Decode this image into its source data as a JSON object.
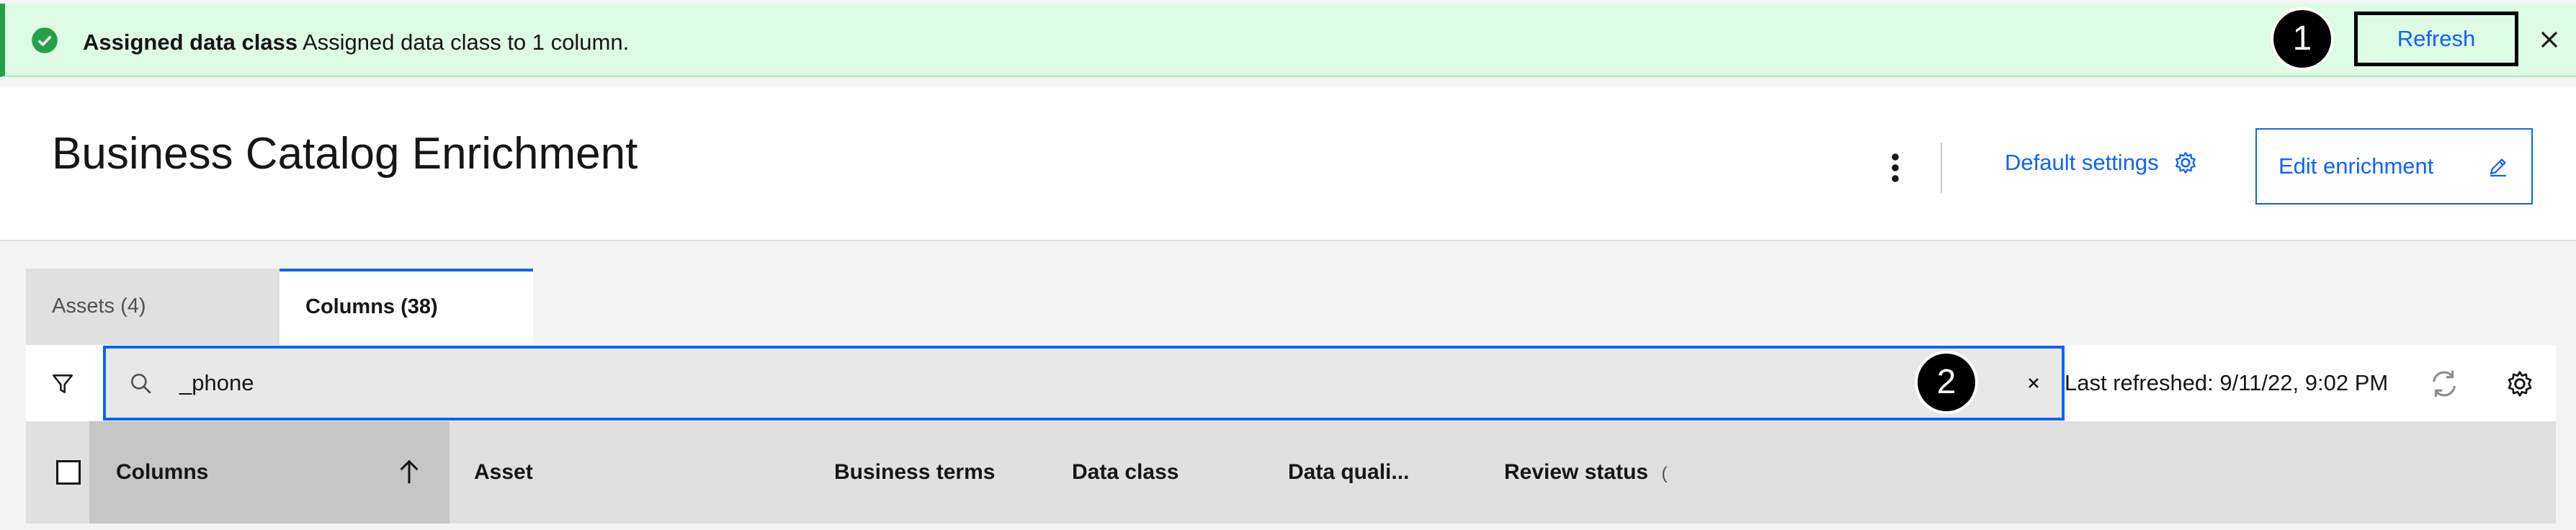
{
  "notification": {
    "title": "Assigned data class",
    "message": "Assigned data class to 1 column.",
    "refresh_label": "Refresh",
    "step_1": "1",
    "status_color": "#24a148"
  },
  "header": {
    "title": "Business Catalog Enrichment",
    "default_settings_label": "Default settings",
    "edit_label": "Edit enrichment"
  },
  "tabs": [
    {
      "label": "Assets (4)",
      "selected": false
    },
    {
      "label": "Columns (38)",
      "selected": true
    }
  ],
  "toolbar": {
    "search_value": "_phone",
    "step_2": "2",
    "last_refreshed": "Last refreshed: 9/11/22, 9:02 PM"
  },
  "table": {
    "columns": [
      "Columns",
      "Asset",
      "Business terms",
      "Data class",
      "Data quali...",
      "Review status"
    ],
    "sort_column": "Columns",
    "sort_direction": "ascending"
  },
  "colors": {
    "accent": "#0f62fe",
    "success_bg": "#defbe6"
  }
}
